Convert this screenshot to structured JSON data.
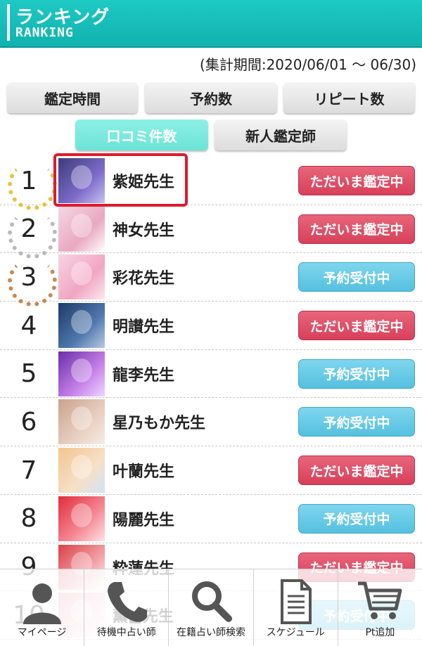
{
  "header": {
    "title": "ランキング",
    "subtitle": "RANKING"
  },
  "period": "(集計期間:2020/06/01 〜 06/30)",
  "tabs": [
    {
      "label": "鑑定時間",
      "active": false
    },
    {
      "label": "予約数",
      "active": false
    },
    {
      "label": "リピート数",
      "active": false
    },
    {
      "label": "口コミ件数",
      "active": true
    },
    {
      "label": "新人鑑定師",
      "active": false
    }
  ],
  "ranking": [
    {
      "rank": "1",
      "name": "紫姫先生",
      "status": "ただいま鑑定中",
      "status_type": "live",
      "medal": "gold"
    },
    {
      "rank": "2",
      "name": "神女先生",
      "status": "ただいま鑑定中",
      "status_type": "live",
      "medal": "silver"
    },
    {
      "rank": "3",
      "name": "彩花先生",
      "status": "予約受付中",
      "status_type": "reserve",
      "medal": "bronze"
    },
    {
      "rank": "4",
      "name": "明讃先生",
      "status": "ただいま鑑定中",
      "status_type": "live",
      "medal": ""
    },
    {
      "rank": "5",
      "name": "龍李先生",
      "status": "予約受付中",
      "status_type": "reserve",
      "medal": ""
    },
    {
      "rank": "6",
      "name": "星乃もか先生",
      "status": "予約受付中",
      "status_type": "reserve",
      "medal": ""
    },
    {
      "rank": "7",
      "name": "叶蘭先生",
      "status": "ただいま鑑定中",
      "status_type": "live",
      "medal": ""
    },
    {
      "rank": "8",
      "name": "陽麗先生",
      "status": "予約受付中",
      "status_type": "reserve",
      "medal": ""
    },
    {
      "rank": "9",
      "name": "粋蓮先生",
      "status": "ただいま鑑定中",
      "status_type": "live",
      "medal": ""
    },
    {
      "rank": "10",
      "name": "薫■先生",
      "status": "予約受付中",
      "status_type": "reserve",
      "medal": ""
    }
  ],
  "bottom_nav": [
    {
      "label": "マイページ",
      "icon": "user-icon"
    },
    {
      "label": "待機中占い師",
      "icon": "phone-icon"
    },
    {
      "label": "在籍占い師検索",
      "icon": "search-icon"
    },
    {
      "label": "スケジュール",
      "icon": "document-icon"
    },
    {
      "label": "Pt追加",
      "icon": "cart-icon"
    }
  ],
  "colors": {
    "header": "#1fc9c4",
    "live": "#d8405a",
    "reserve": "#55c0df",
    "active_tab": "#6be3d6",
    "highlight": "#e0192c",
    "gold": "#e6c33a",
    "silver": "#b9b9b9",
    "bronze": "#c9874e"
  }
}
